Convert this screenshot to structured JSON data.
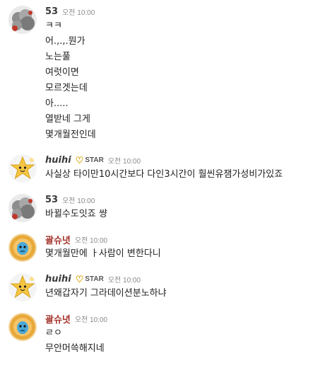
{
  "messages": [
    {
      "user": "53",
      "avatar": "grey-smoke-avatar",
      "time": "오전 10:00",
      "lines": [
        "ㅋㅋ",
        "어.,.,.뭔가",
        "노는풀",
        "여럿이면",
        "모르겟는데",
        "아.....",
        "열받네 그게",
        "몇개월전인데"
      ]
    },
    {
      "user": "huihi",
      "avatar": "star-avatar",
      "badge": "STAR",
      "time": "오전 10:00",
      "lines": [
        "사실상 타이만10시간보다 다인3시간이 훨씬유잼가성비가있죠"
      ]
    },
    {
      "user": "53",
      "avatar": "grey-smoke-avatar",
      "time": "오전 10:00",
      "lines": [
        "바뀔수도잇죠 썅"
      ]
    },
    {
      "user": "괄슈녓",
      "avatar": "blue-creature-avatar",
      "time": "오전 10:00",
      "lines": [
        "몇개월만에 ㅏ사람이 변한다니"
      ]
    },
    {
      "user": "huihi",
      "avatar": "star-avatar",
      "badge": "STAR",
      "time": "오전 10:00",
      "lines": [
        "년왜갑자기 그라데이션분노하냐"
      ]
    },
    {
      "user": "괄슈녓",
      "avatar": "blue-creature-avatar",
      "time": "오전 10:00",
      "lines": [
        "ㄹㅇ",
        "무안머쓱해지네"
      ]
    }
  ],
  "colors": {
    "username_red": "#a4332b",
    "badge_heart": "#d9a400"
  }
}
